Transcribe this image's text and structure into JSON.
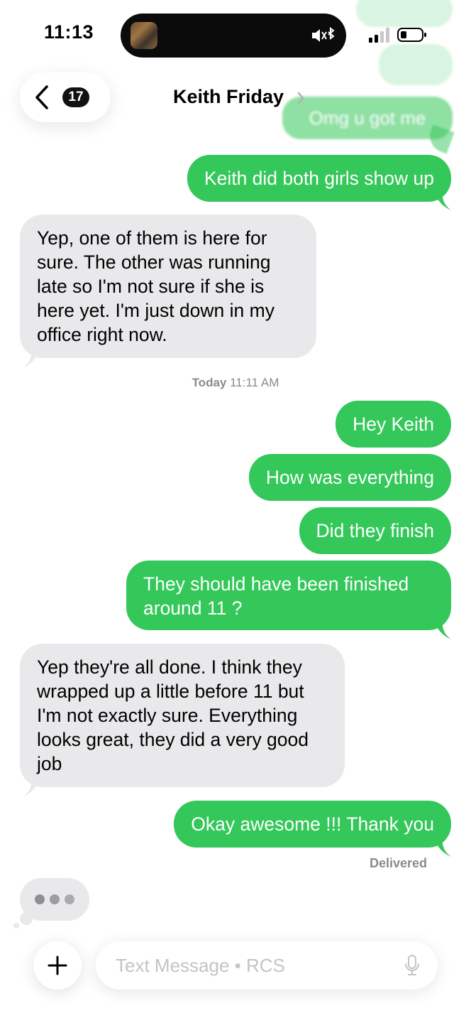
{
  "status_bar": {
    "time": "11:13"
  },
  "header": {
    "back_count": "17",
    "contact_name": "Keith Friday"
  },
  "earlier": {
    "faded_message": "Omg u got me"
  },
  "messages": [
    {
      "dir": "out",
      "text": "Keith did both girls show up"
    },
    {
      "dir": "in",
      "text": "Yep, one of them is here for sure. The other was running late so I'm not sure if she is here yet. I'm just down in my office right now."
    },
    {
      "dir": "out",
      "text": "Hey Keith"
    },
    {
      "dir": "out",
      "text": "How was everything"
    },
    {
      "dir": "out",
      "text": "Did they finish"
    },
    {
      "dir": "out",
      "text": "They should have been finished around 11 ?"
    },
    {
      "dir": "in",
      "text": "Yep they're all done. I think they wrapped up a little before 11 but I'm not exactly sure. Everything looks great, they did a very good job"
    },
    {
      "dir": "out",
      "text": "Okay awesome !!! Thank you"
    }
  ],
  "timestamp": {
    "day": "Today",
    "time": "11:11 AM"
  },
  "delivered_label": "Delivered",
  "compose": {
    "placeholder": "Text Message • RCS"
  },
  "colors": {
    "outgoing": "#34c759",
    "incoming": "#e9e9eb"
  }
}
